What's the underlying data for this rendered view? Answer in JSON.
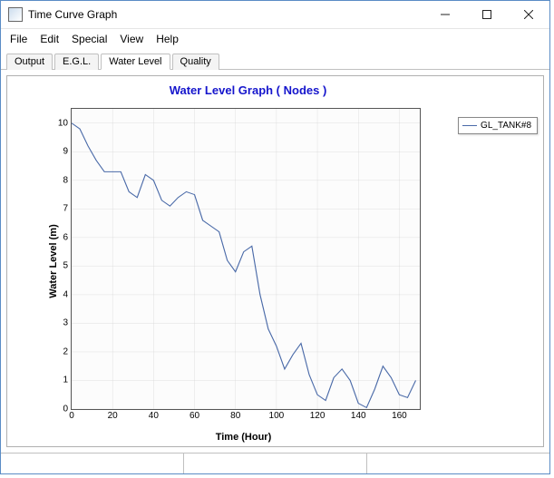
{
  "window": {
    "title": "Time Curve Graph"
  },
  "menu": {
    "file": "File",
    "edit": "Edit",
    "special": "Special",
    "view": "View",
    "help": "Help"
  },
  "tabs": {
    "output": "Output",
    "egl": "E.G.L.",
    "water": "Water Level",
    "quality": "Quality",
    "active": "water"
  },
  "chart_data": {
    "type": "line",
    "title": "Water Level Graph ( Nodes )",
    "xlabel": "Time (Hour)",
    "ylabel": "Water Level (m)",
    "xlim": [
      0,
      170
    ],
    "ylim": [
      0,
      10.5
    ],
    "xticks": [
      0,
      20,
      40,
      60,
      80,
      100,
      120,
      140,
      160
    ],
    "yticks": [
      0,
      1,
      2,
      3,
      4,
      5,
      6,
      7,
      8,
      9,
      10
    ],
    "series": [
      {
        "name": "GL_TANK#8",
        "color": "#4a6aa8",
        "x": [
          0,
          4,
          8,
          12,
          16,
          20,
          24,
          28,
          32,
          36,
          40,
          44,
          48,
          52,
          56,
          60,
          64,
          68,
          72,
          76,
          80,
          84,
          88,
          92,
          96,
          100,
          104,
          108,
          112,
          116,
          120,
          124,
          128,
          132,
          136,
          140,
          144,
          148,
          152,
          156,
          160,
          164,
          168
        ],
        "values": [
          10.0,
          9.8,
          9.2,
          8.7,
          8.3,
          8.3,
          8.3,
          7.6,
          7.4,
          8.2,
          8.0,
          7.3,
          7.1,
          7.4,
          7.6,
          7.5,
          6.6,
          6.4,
          6.2,
          5.2,
          4.8,
          5.5,
          5.7,
          4.0,
          2.8,
          2.2,
          1.4,
          1.9,
          2.3,
          1.2,
          0.5,
          0.3,
          1.1,
          1.4,
          1.0,
          0.2,
          0.05,
          0.7,
          1.5,
          1.1,
          0.5,
          0.4,
          1.0
        ]
      }
    ]
  },
  "statusbar": {
    "seg1": "",
    "seg2": "",
    "seg3": ""
  }
}
